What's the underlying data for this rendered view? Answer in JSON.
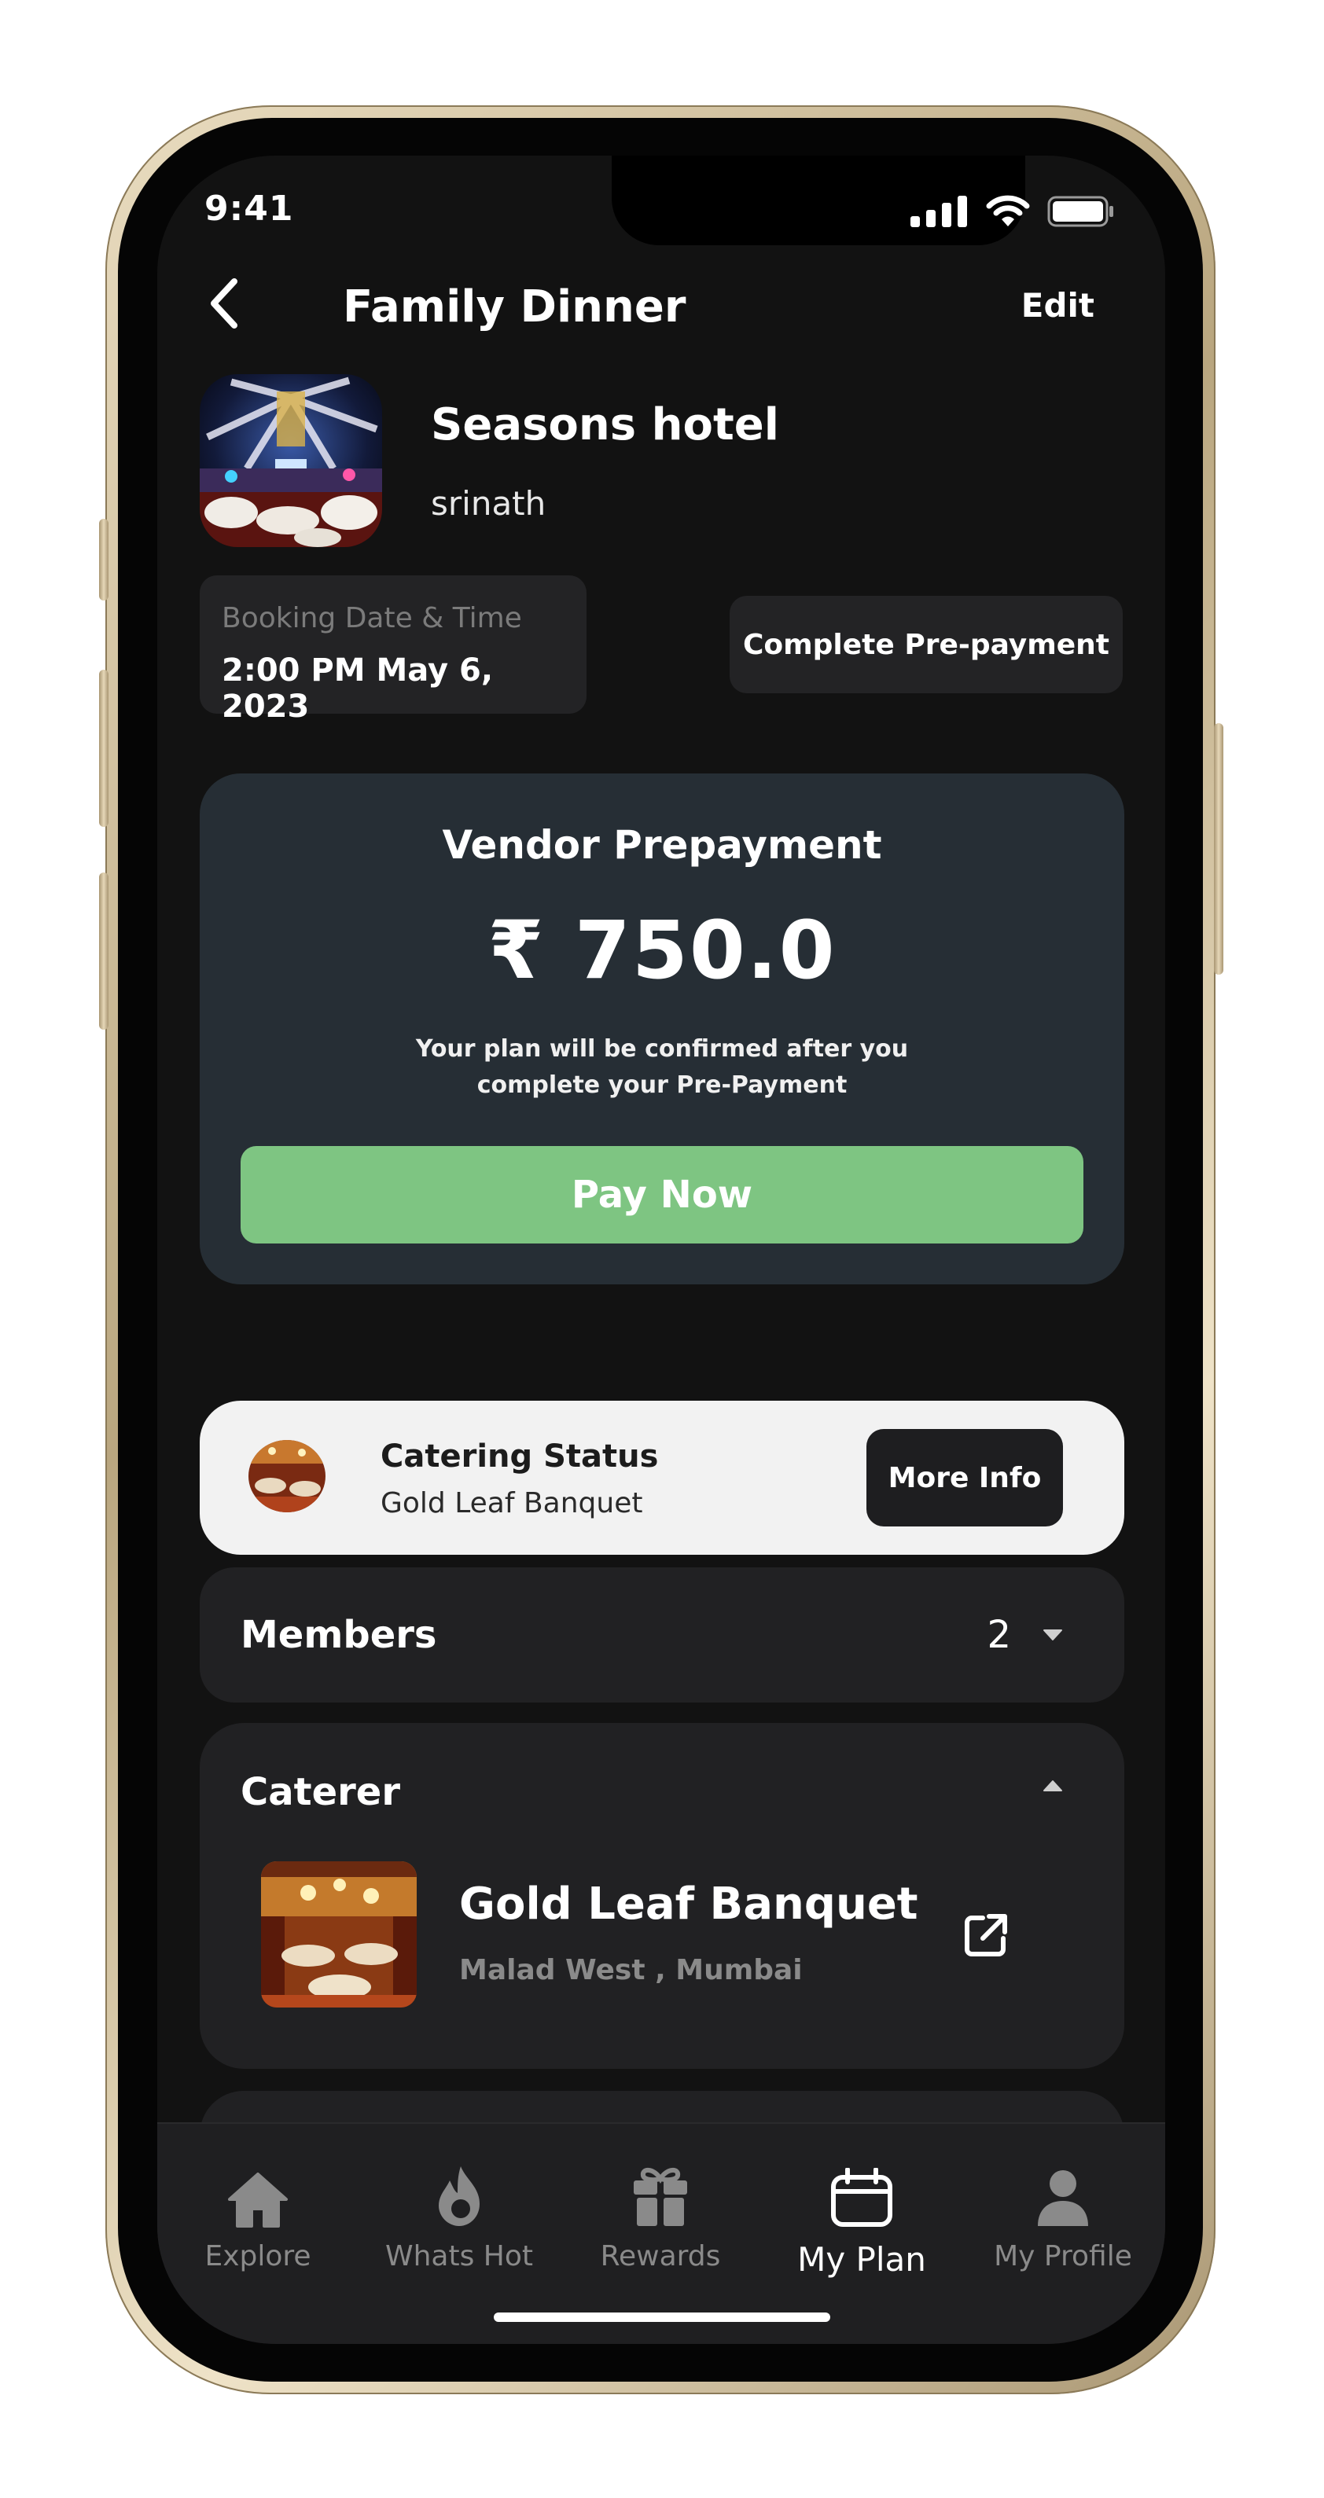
{
  "status_bar": {
    "time": "9:41"
  },
  "header": {
    "title": "Family Dinner",
    "edit_label": "Edit"
  },
  "venue": {
    "name": "Seasons hotel",
    "owner": "srinath"
  },
  "booking": {
    "label": "Booking Date & Time",
    "value": "2:00 PM May 6, 2023"
  },
  "prepayment_chip": {
    "label": "Complete Pre-payment"
  },
  "vendor_prepayment": {
    "title": "Vendor Prepayment",
    "amount": "₹ 750.0",
    "note_line1": "Your plan will be confirmed after you",
    "note_line2": "complete your Pre-Payment",
    "pay_button": "Pay Now",
    "pay_color": "#7ec582"
  },
  "catering_status": {
    "title": "Catering Status",
    "subtitle": "Gold Leaf Banquet",
    "button": "More Info"
  },
  "members": {
    "label": "Members",
    "count": "2"
  },
  "caterer": {
    "label": "Caterer",
    "name": "Gold Leaf Banquet",
    "location": "Malad West , Mumbai"
  },
  "tabs": [
    {
      "label": "Explore",
      "icon": "home-icon"
    },
    {
      "label": "Whats Hot",
      "icon": "flame-icon"
    },
    {
      "label": "Rewards",
      "icon": "gift-icon"
    },
    {
      "label": "My Plan",
      "icon": "calendar-icon",
      "active": true
    },
    {
      "label": "My Profile",
      "icon": "person-icon"
    }
  ]
}
